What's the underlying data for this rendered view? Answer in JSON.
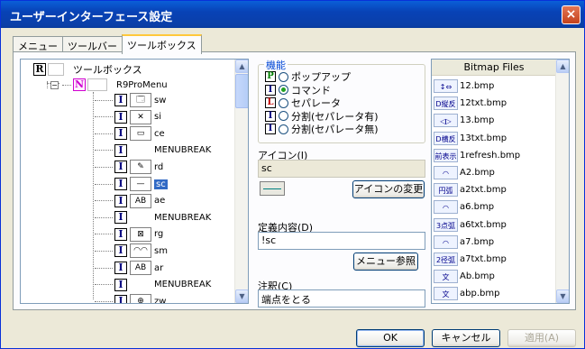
{
  "window": {
    "title": "ユーザーインターフェース設定",
    "close_glyph": "×"
  },
  "tabs": [
    {
      "label": "メニュー"
    },
    {
      "label": "ツールバー"
    },
    {
      "label": "ツールボックス"
    }
  ],
  "tree": {
    "root": {
      "badge": "R",
      "label": "ツールボックス"
    },
    "menu": {
      "badge": "N",
      "label": "R9ProMenu"
    },
    "items": [
      {
        "badge": "I",
        "icon": "sw-icon",
        "icon_glyph": "🗔",
        "label": "sw"
      },
      {
        "badge": "I",
        "icon": "split-icon",
        "icon_glyph": "✕",
        "label": "si"
      },
      {
        "badge": "I",
        "icon": "ce-icon",
        "icon_glyph": "▭",
        "label": "ce"
      },
      {
        "badge": "I",
        "icon": "",
        "icon_glyph": "",
        "label": "MENUBREAK"
      },
      {
        "badge": "I",
        "icon": "pencil-icon",
        "icon_glyph": "✎",
        "label": "rd"
      },
      {
        "badge": "I",
        "icon": "line-icon",
        "icon_glyph": "—",
        "label": "sc",
        "selected": true
      },
      {
        "badge": "I",
        "icon": "ae-icon",
        "icon_glyph": "AB",
        "label": "ae"
      },
      {
        "badge": "I",
        "icon": "",
        "icon_glyph": "",
        "label": "MENUBREAK"
      },
      {
        "badge": "I",
        "icon": "rg-icon",
        "icon_glyph": "⊠",
        "label": "rg"
      },
      {
        "badge": "I",
        "icon": "sm-icon",
        "icon_glyph": "◠◠",
        "label": "sm"
      },
      {
        "badge": "I",
        "icon": "ar-icon",
        "icon_glyph": "AB",
        "label": "ar"
      },
      {
        "badge": "I",
        "icon": "",
        "icon_glyph": "",
        "label": "MENUBREAK"
      },
      {
        "badge": "I",
        "icon": "zoom-icon",
        "icon_glyph": "⊕",
        "label": "zw"
      }
    ]
  },
  "function_group": {
    "legend": "機能",
    "options": [
      {
        "badge": "P",
        "label": "ポップアップ",
        "checked": false
      },
      {
        "badge": "I",
        "label": "コマンド",
        "checked": true
      },
      {
        "badge": "L",
        "label": "セパレータ",
        "checked": false
      },
      {
        "badge": "I",
        "label": "分割(セパレータ有)",
        "checked": false
      },
      {
        "badge": "I",
        "label": "分割(セパレータ無)",
        "checked": false
      }
    ]
  },
  "icon_field": {
    "label": "アイコン(I)",
    "value": "sc",
    "change_button": "アイコンの変更"
  },
  "definition_field": {
    "label": "定義内容(D)",
    "value": "!sc",
    "menu_ref_button": "メニュー参照"
  },
  "note_field": {
    "label": "注釈(C)",
    "value": "端点をとる"
  },
  "bitmap_list": {
    "header": "Bitmap Files",
    "files": [
      {
        "icon": "↕⇔",
        "name": "12.bmp"
      },
      {
        "icon": "D縦反",
        "name": "12txt.bmp"
      },
      {
        "icon": "◁▷",
        "name": "13.bmp"
      },
      {
        "icon": "D横反",
        "name": "13txt.bmp"
      },
      {
        "icon": "前表示",
        "name": "1refresh.bmp"
      },
      {
        "icon": "◠",
        "name": "A2.bmp"
      },
      {
        "icon": "円弧",
        "name": "a2txt.bmp"
      },
      {
        "icon": "◠",
        "name": "a6.bmp"
      },
      {
        "icon": "3点弧",
        "name": "a6txt.bmp"
      },
      {
        "icon": "◠",
        "name": "a7.bmp"
      },
      {
        "icon": "2径弧",
        "name": "a7txt.bmp"
      },
      {
        "icon": "文",
        "name": "Ab.bmp"
      },
      {
        "icon": "文",
        "name": "abp.bmp"
      }
    ]
  },
  "buttons": {
    "ok": "OK",
    "cancel": "キャンセル",
    "apply": "適用(A)"
  }
}
